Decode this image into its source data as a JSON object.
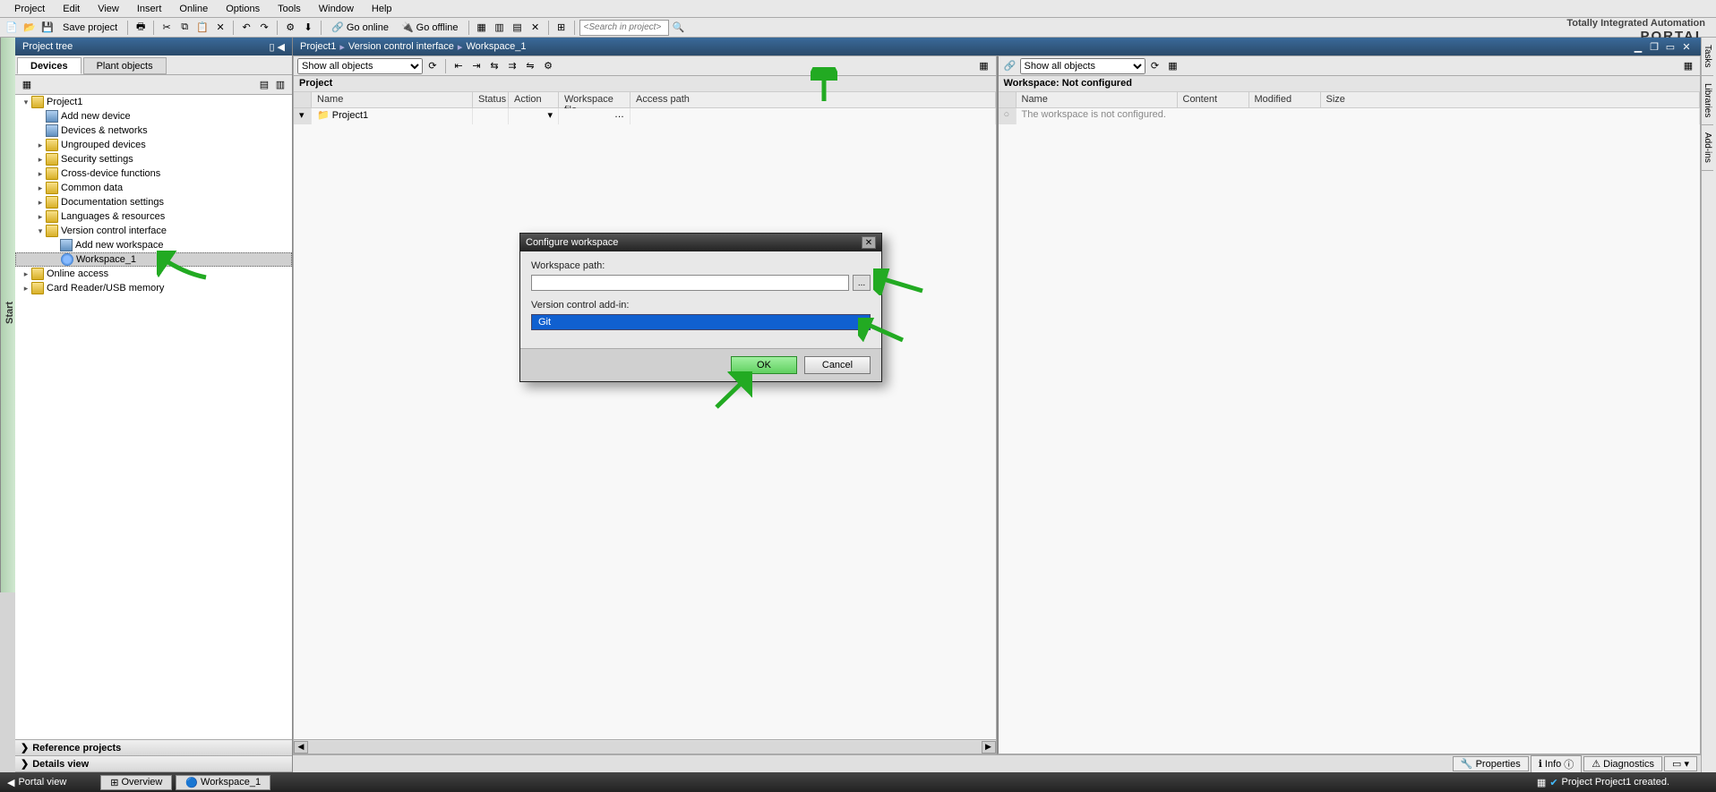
{
  "menu": [
    "Project",
    "Edit",
    "View",
    "Insert",
    "Online",
    "Options",
    "Tools",
    "Window",
    "Help"
  ],
  "toolbar": {
    "save_label": "Save project",
    "go_online": "Go online",
    "go_offline": "Go offline",
    "search_placeholder": "<Search in project>"
  },
  "brand": {
    "line1": "Totally Integrated Automation",
    "line2": "PORTAL"
  },
  "start_tab": "Start",
  "project_tree": {
    "title": "Project tree",
    "tabs": {
      "devices": "Devices",
      "plant": "Plant objects"
    },
    "items": [
      {
        "label": "Project1",
        "indent": 0,
        "arrow": "down",
        "icon": "folder"
      },
      {
        "label": "Add new device",
        "indent": 1,
        "icon": "device"
      },
      {
        "label": "Devices & networks",
        "indent": 1,
        "icon": "device"
      },
      {
        "label": "Ungrouped devices",
        "indent": 1,
        "arrow": "right",
        "icon": "folder"
      },
      {
        "label": "Security settings",
        "indent": 1,
        "arrow": "right",
        "icon": "folder"
      },
      {
        "label": "Cross-device functions",
        "indent": 1,
        "arrow": "right",
        "icon": "folder"
      },
      {
        "label": "Common data",
        "indent": 1,
        "arrow": "right",
        "icon": "folder"
      },
      {
        "label": "Documentation settings",
        "indent": 1,
        "arrow": "right",
        "icon": "folder"
      },
      {
        "label": "Languages & resources",
        "indent": 1,
        "arrow": "right",
        "icon": "folder"
      },
      {
        "label": "Version control interface",
        "indent": 1,
        "arrow": "down",
        "icon": "folder"
      },
      {
        "label": "Add new workspace",
        "indent": 2,
        "icon": "device"
      },
      {
        "label": "Workspace_1",
        "indent": 2,
        "icon": "ws",
        "selected": true
      },
      {
        "label": "Online access",
        "indent": 0,
        "arrow": "right",
        "icon": "folder"
      },
      {
        "label": "Card Reader/USB memory",
        "indent": 0,
        "arrow": "right",
        "icon": "folder"
      }
    ],
    "sections": {
      "reference": "Reference projects",
      "details": "Details view"
    }
  },
  "breadcrumb": [
    "Project1",
    "Version control interface",
    "Workspace_1"
  ],
  "project_pane": {
    "filter": "Show all objects",
    "header": "Project",
    "columns": [
      "Name",
      "Status",
      "Action",
      "Workspace file",
      "Access path"
    ],
    "rows": [
      {
        "name": "Project1"
      }
    ]
  },
  "workspace_pane": {
    "filter": "Show all objects",
    "header": "Workspace: Not configured",
    "columns": [
      "Name",
      "Content",
      "Modified",
      "Size"
    ],
    "message": "The workspace is not configured."
  },
  "right_tabs": [
    "Tasks",
    "Libraries",
    "Add-ins"
  ],
  "prop_row": {
    "properties": "Properties",
    "info": "Info",
    "diagnostics": "Diagnostics"
  },
  "status": {
    "portal_view": "Portal view",
    "overview": "Overview",
    "workspace": "Workspace_1",
    "message": "Project Project1 created."
  },
  "dialog": {
    "title": "Configure workspace",
    "path_label": "Workspace path:",
    "path_value": "",
    "addin_label": "Version control add-in:",
    "addin_value": "Git",
    "ok": "OK",
    "cancel": "Cancel"
  }
}
